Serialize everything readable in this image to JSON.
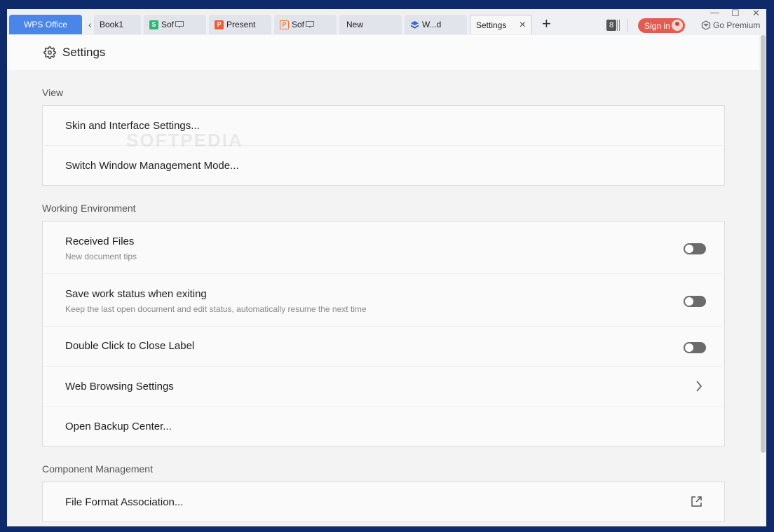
{
  "tabs": {
    "app_label": "WPS Office",
    "items": [
      {
        "label": "Book1",
        "icon": "none"
      },
      {
        "label": "Sof",
        "icon": "spreadsheet-icon"
      },
      {
        "label": "Present",
        "icon": "presentation-icon"
      },
      {
        "label": "Sof",
        "icon": "pdf-icon"
      },
      {
        "label": "New",
        "icon": "none"
      },
      {
        "label": "W...d",
        "icon": "layers-icon"
      },
      {
        "label": "Settings",
        "icon": "none"
      }
    ],
    "tab_count": "8"
  },
  "account": {
    "signin_label": "Sign in",
    "premium_label": "Go Premium"
  },
  "window_controls": {
    "minimize": "—",
    "maximize": "☐",
    "close": "✕"
  },
  "page": {
    "title": "Settings"
  },
  "watermark": "SOFTPEDIA",
  "sections": [
    {
      "title": "View",
      "rows": [
        {
          "label": "Skin and Interface Settings..."
        },
        {
          "label": "Switch Window Management Mode..."
        }
      ]
    },
    {
      "title": "Working Environment",
      "rows": [
        {
          "label": "Received Files",
          "sub": "New document tips",
          "control": "toggle",
          "value": false
        },
        {
          "label": "Save work status when exiting",
          "sub": "Keep the last open document and edit status, automatically resume the next time",
          "control": "toggle",
          "value": false
        },
        {
          "label": "Double Click to Close Label",
          "control": "toggle",
          "value": false
        },
        {
          "label": "Web Browsing Settings",
          "control": "chevron"
        },
        {
          "label": "Open Backup Center..."
        }
      ]
    },
    {
      "title": "Component Management",
      "rows": [
        {
          "label": "File Format Association...",
          "control": "external-link"
        }
      ]
    }
  ],
  "colors": {
    "wps_tab": "#4a86e8",
    "signin": "#e05d52",
    "toggle_off": "#6b6b6b",
    "desktop_bg": "#0f2a6b"
  }
}
